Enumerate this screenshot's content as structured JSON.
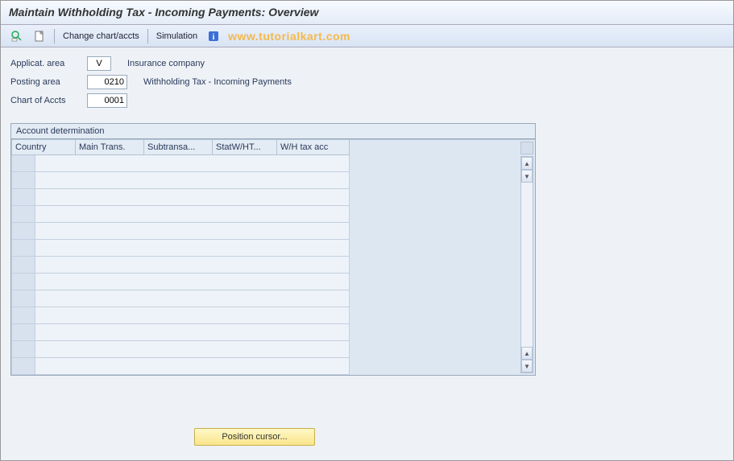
{
  "title": "Maintain Withholding Tax - Incoming Payments: Overview",
  "toolbar": {
    "change_chart": "Change chart/accts",
    "simulation": "Simulation"
  },
  "watermark": "www.tutorialkart.com",
  "form": {
    "applicat_label": "Applicat. area",
    "applicat_value": "V",
    "applicat_desc": "Insurance company",
    "posting_label": "Posting area",
    "posting_value": "0210",
    "posting_desc": "Withholding Tax - Incoming Payments",
    "chart_label": "Chart of Accts",
    "chart_value": "0001"
  },
  "panel": {
    "title": "Account determination",
    "columns": [
      "Country",
      "Main Trans.",
      "Subtransa...",
      "StatW/HT...",
      "W/H tax acc"
    ],
    "row_count": 13
  },
  "button": {
    "position_cursor": "Position cursor..."
  }
}
